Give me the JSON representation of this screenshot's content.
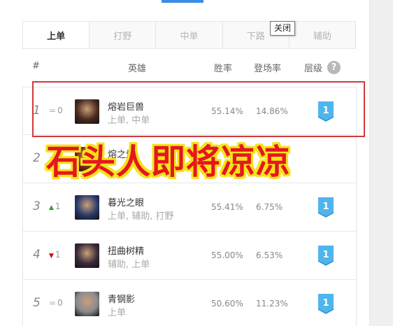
{
  "tabs": [
    {
      "label": "上单",
      "active": true
    },
    {
      "label": "打野",
      "active": false
    },
    {
      "label": "中单",
      "active": false
    },
    {
      "label": "下路",
      "active": false
    },
    {
      "label": "辅助",
      "active": false
    }
  ],
  "tooltip": "关闭",
  "header": {
    "rank": "#",
    "hero": "英雄",
    "win_rate": "胜率",
    "pick_rate": "登场率",
    "tier": "层级",
    "help_icon": "?"
  },
  "rows": [
    {
      "rank": "1",
      "trend": "same",
      "trend_value": "0",
      "name": "熔岩巨兽",
      "roles": "上单, 中单",
      "win_rate": "55.14%",
      "pick_rate": "14.86%",
      "tier": "1",
      "avatar_color": "#4a2a1e"
    },
    {
      "rank": "2",
      "trend": "same",
      "trend_value": "",
      "name": "熔之焰",
      "roles": "",
      "win_rate": "",
      "pick_rate": "",
      "tier": "",
      "avatar_color": "#7a2a12"
    },
    {
      "rank": "3",
      "trend": "up",
      "trend_value": "1",
      "name": "暮光之眼",
      "roles": "上单, 辅助, 打野",
      "win_rate": "55.41%",
      "pick_rate": "6.75%",
      "tier": "1",
      "avatar_color": "#2a3a6a"
    },
    {
      "rank": "4",
      "trend": "down",
      "trend_value": "1",
      "name": "扭曲树精",
      "roles": "辅助, 上单",
      "win_rate": "55.00%",
      "pick_rate": "6.53%",
      "tier": "1",
      "avatar_color": "#3a2a3a"
    },
    {
      "rank": "5",
      "trend": "same",
      "trend_value": "0",
      "name": "青钢影",
      "roles": "上单",
      "win_rate": "50.60%",
      "pick_rate": "11.23%",
      "tier": "1",
      "avatar_color": "#8a8a90"
    }
  ],
  "banner": "石头人即将凉凉",
  "colors": {
    "accent": "#3a8ee6",
    "tier_badge": "#4fb5ec",
    "highlight": "#d03a3a",
    "banner_text": "#e5161f",
    "banner_outline": "#f7e21a"
  }
}
